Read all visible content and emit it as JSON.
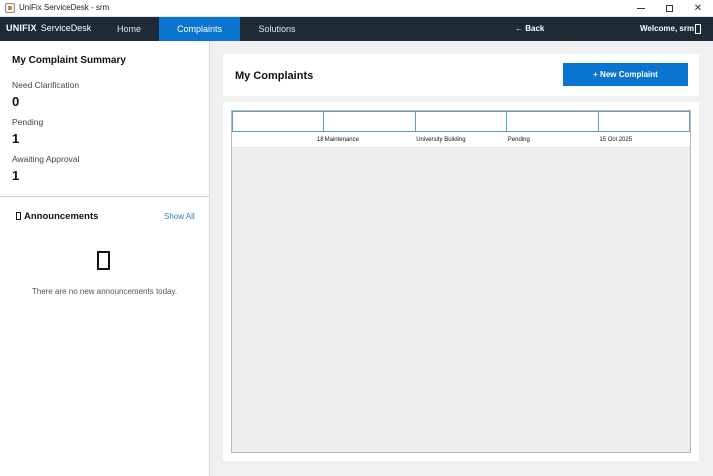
{
  "window": {
    "title": "UniFix ServiceDesk - srm",
    "icon": "app-icon"
  },
  "nav": {
    "brand_strong": "UNIFIX",
    "brand_rest": "ServiceDesk",
    "tabs": [
      {
        "label": "Home"
      },
      {
        "label": "Complaints",
        "active": true
      },
      {
        "label": "Solutions"
      }
    ],
    "back_label": "← Back",
    "welcome": "Welcome, srm",
    "active_color": "#0a74d1",
    "bar_color": "#1d2b36"
  },
  "sidebar": {
    "summary_title": "My Complaint Summary",
    "stats": [
      {
        "label": "Need Clarification",
        "value": "0"
      },
      {
        "label": "Pending",
        "value": "1"
      },
      {
        "label": "Awaiting Approval",
        "value": "1"
      }
    ],
    "announcements": {
      "title": "Announcements",
      "show_all": "Show All",
      "empty_text": "There are no new announcements today."
    }
  },
  "main": {
    "title": "My Complaints",
    "new_button": "+ New Complaint",
    "table": {
      "headers": [
        "",
        "",
        "",
        "",
        ""
      ],
      "rows": [
        {
          "id": "18",
          "category": "Maintenance",
          "location": "University Building",
          "status": "Pending",
          "date": "15 Oct 2025"
        }
      ]
    }
  }
}
